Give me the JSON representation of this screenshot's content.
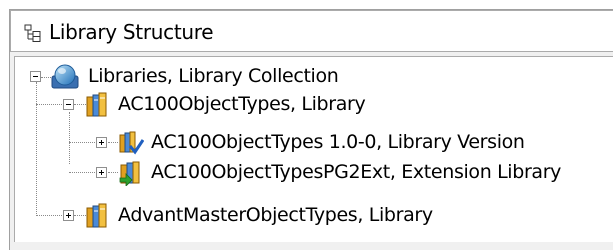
{
  "panel": {
    "title": "Library Structure",
    "title_icon": "tree-structure-icon"
  },
  "tree": {
    "root": {
      "label": "Libraries, Library Collection",
      "icon": "globe-collection-icon",
      "expanded": true,
      "children": [
        {
          "label": "AC100ObjectTypes, Library",
          "icon": "library-books-icon",
          "expanded": true,
          "children": [
            {
              "label": "AC100ObjectTypes 1.0-0, Library Version",
              "icon": "library-version-icon",
              "expanded": false
            },
            {
              "label": "AC100ObjectTypesPG2Ext, Extension Library",
              "icon": "extension-library-icon",
              "expanded": false
            }
          ]
        },
        {
          "label": "AdvantMasterObjectTypes, Library",
          "icon": "library-books-icon",
          "expanded": false
        }
      ]
    }
  },
  "colors": {
    "background": "#ffffff",
    "frame": "#f0f0f0",
    "border": "#ababab",
    "tree_lines": "#8a8a8a"
  }
}
